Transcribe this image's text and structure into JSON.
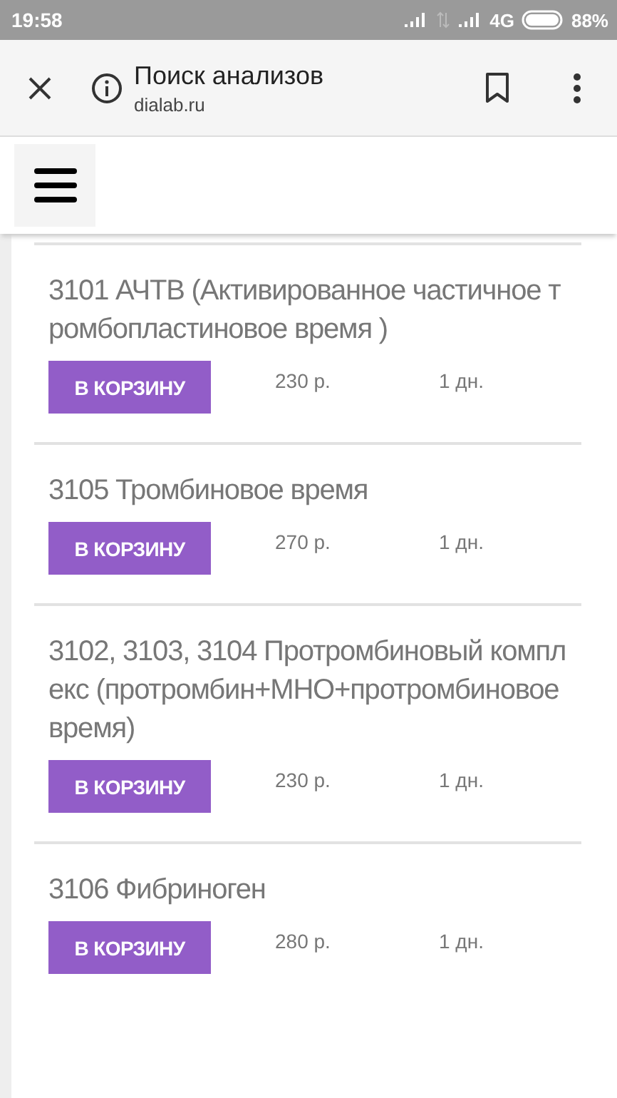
{
  "status_bar": {
    "time": "19:58",
    "network": "4G",
    "battery": "88%"
  },
  "browser": {
    "title": "Поиск анализов",
    "url": "dialab.ru"
  },
  "tests": [
    {
      "title": "3101 АЧТВ (Активированное частичное тромбопластиновое время )",
      "button": "В КОРЗИНУ",
      "price": "230 р.",
      "duration": "1 дн."
    },
    {
      "title": "3105 Тромбиновое время",
      "button": "В КОРЗИНУ",
      "price": "270 р.",
      "duration": "1 дн."
    },
    {
      "title": "3102, 3103, 3104 Протромбиновый комплекс (протромбин+МНО+протромбиновое время)",
      "button": "В КОРЗИНУ",
      "price": "230 р.",
      "duration": "1 дн."
    },
    {
      "title": "3106 Фибриноген",
      "button": "В КОРЗИНУ",
      "price": "280 р.",
      "duration": "1 дн."
    }
  ]
}
